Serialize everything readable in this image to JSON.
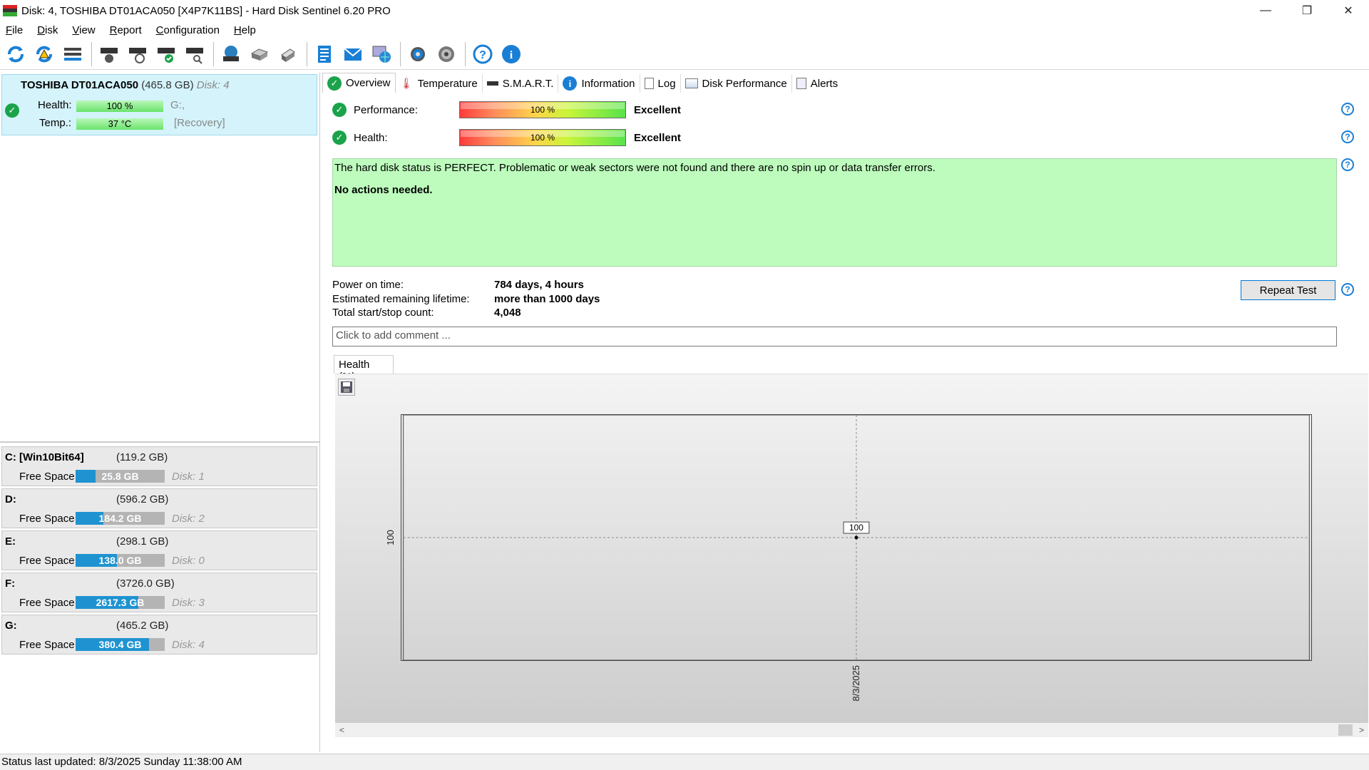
{
  "window": {
    "title": "Disk: 4, TOSHIBA DT01ACA050 [X4P7K11BS]  -  Hard Disk Sentinel 6.20 PRO",
    "controls": {
      "minimize": "—",
      "maximize": "❐",
      "close": "✕"
    }
  },
  "menu": [
    "File",
    "Disk",
    "View",
    "Report",
    "Configuration",
    "Help"
  ],
  "toolbar_icons": [
    "refresh-icon",
    "refresh-warning-icon",
    "disk-list-icon",
    "disk-test-icon",
    "disk-schedule-icon",
    "disk-check-icon",
    "disk-search-icon",
    "network-disk-icon",
    "drive-icon",
    "usb-drive-icon",
    "report-icon",
    "email-icon",
    "web-report-icon",
    "settings-icon",
    "sound-icon",
    "help-icon",
    "about-icon"
  ],
  "disk_card": {
    "name": "TOSHIBA DT01ACA050",
    "size": "(465.8 GB)",
    "disk_no": "Disk: 4",
    "health_label": "Health:",
    "health_value": "100 %",
    "health_drive": "G:,",
    "temp_label": "Temp.:",
    "temp_value": "37 °C",
    "temp_note": "[Recovery]"
  },
  "volumes": [
    {
      "letter": "C: [Win10Bit64]",
      "size": "(119.2 GB)",
      "free_label": "Free Space",
      "free": "25.8 GB",
      "free_fraction": 0.22,
      "disk": "Disk: 1"
    },
    {
      "letter": "D:",
      "size": "(596.2 GB)",
      "free_label": "Free Space",
      "free": "184.2 GB",
      "free_fraction": 0.31,
      "disk": "Disk: 2"
    },
    {
      "letter": "E:",
      "size": "(298.1 GB)",
      "free_label": "Free Space",
      "free": "138.0 GB",
      "free_fraction": 0.46,
      "disk": "Disk: 0"
    },
    {
      "letter": "F:",
      "size": "(3726.0 GB)",
      "free_label": "Free Space",
      "free": "2617.3 GB",
      "free_fraction": 0.7,
      "disk": "Disk: 3"
    },
    {
      "letter": "G:",
      "size": "(465.2 GB)",
      "free_label": "Free Space",
      "free": "380.4 GB",
      "free_fraction": 0.82,
      "disk": "Disk: 4"
    }
  ],
  "tabs": [
    "Overview",
    "Temperature",
    "S.M.A.R.T.",
    "Information",
    "Log",
    "Disk Performance",
    "Alerts"
  ],
  "overview": {
    "performance_label": "Performance:",
    "performance_value": "100 %",
    "performance_rating": "Excellent",
    "health_label": "Health:",
    "health_value": "100 %",
    "health_rating": "Excellent",
    "status_line1": "The hard disk status is PERFECT. Problematic or weak sectors were not found and there are no spin up or data transfer errors.",
    "status_line2": "No actions needed.",
    "power_on_label": "Power on time:",
    "power_on_value": "784 days, 4 hours",
    "lifetime_label": "Estimated remaining lifetime:",
    "lifetime_value": "more than 1000 days",
    "startstop_label": "Total start/stop count:",
    "startstop_value": "4,048",
    "repeat_button": "Repeat Test",
    "comment_placeholder": "Click to add comment ..."
  },
  "chart_tab": "Health (%)",
  "chart_data": {
    "type": "line",
    "x": [
      "8/3/2025"
    ],
    "series": [
      {
        "values": [
          100
        ]
      }
    ],
    "ytick": "100",
    "data_label": "100"
  },
  "statusbar": "Status last updated: 8/3/2025 Sunday 11:38:00 AM",
  "colors": {
    "accent": "#1f93d1",
    "ok": "#1aa34a",
    "status_bg": "#bdfcbd",
    "card_bg": "#d4f3fb"
  }
}
